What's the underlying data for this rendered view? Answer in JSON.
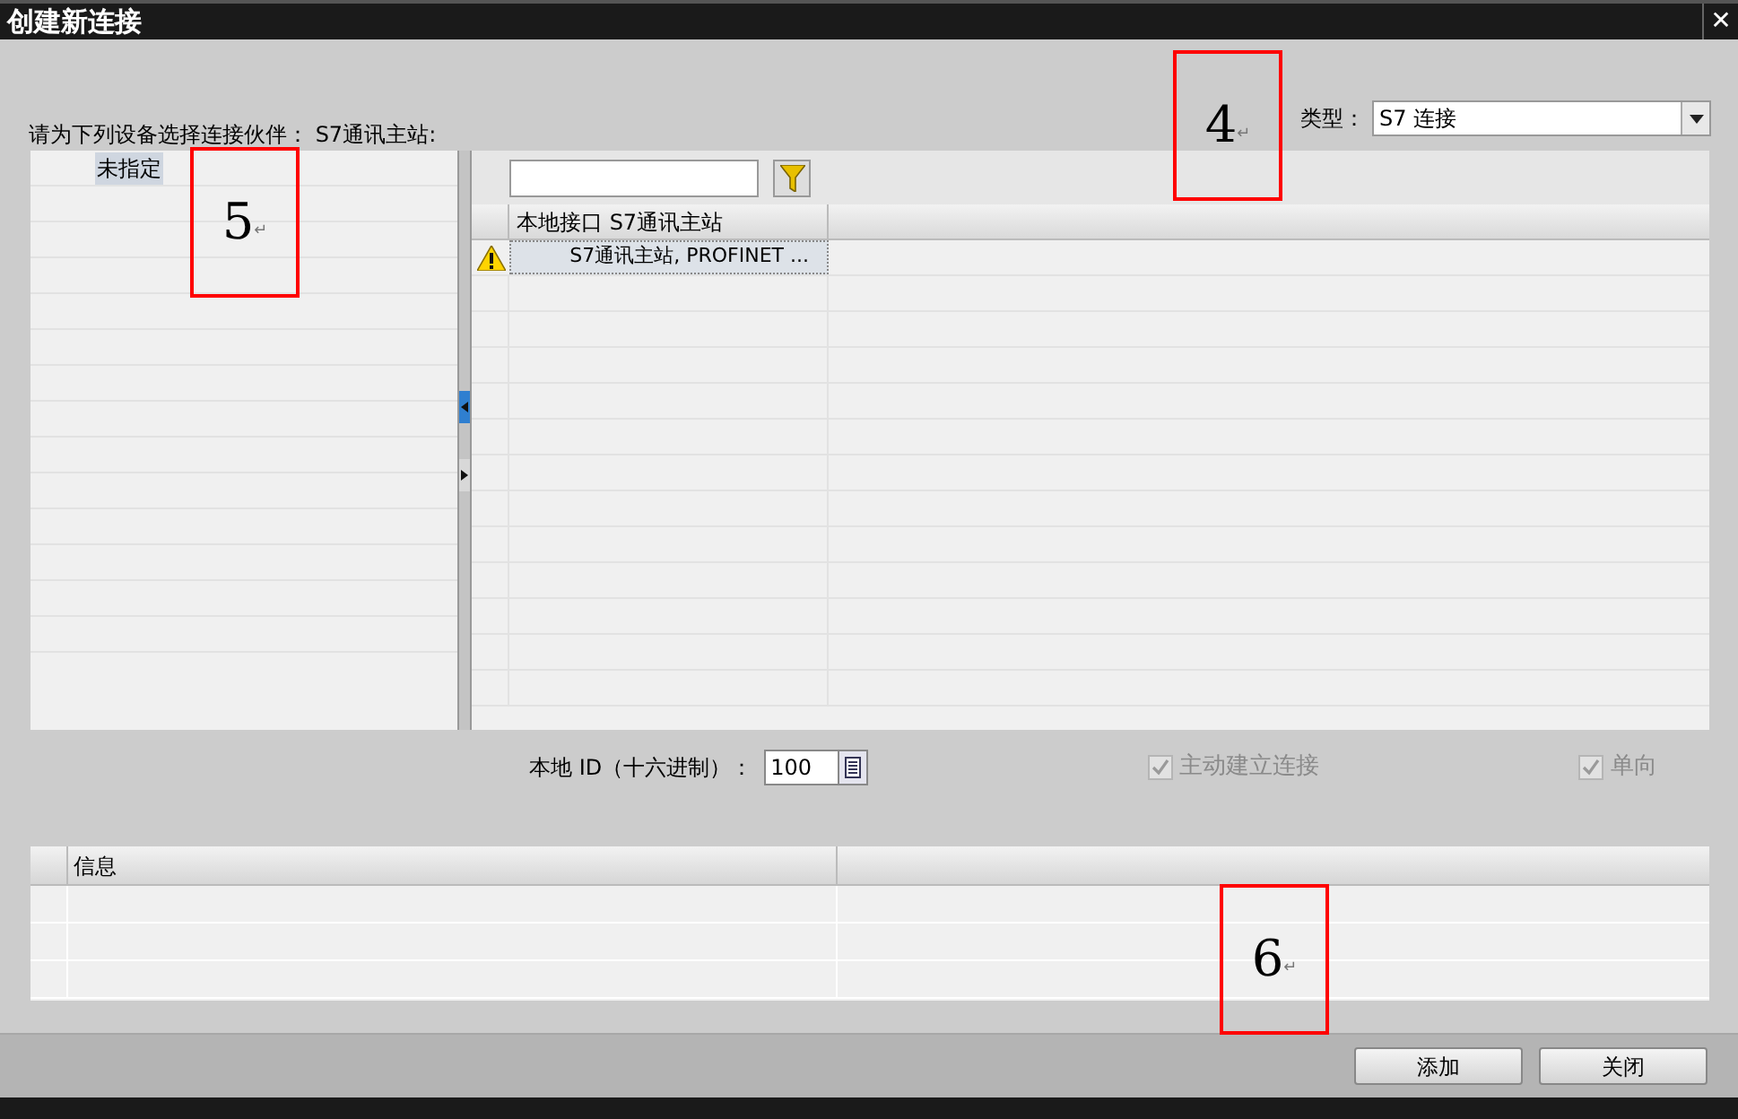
{
  "window": {
    "title": "创建新连接",
    "close": "✕"
  },
  "prompt": "请为下列设备选择连接伙伴： S7通讯主站:",
  "type_field": {
    "label": "类型：",
    "value": "S7 连接"
  },
  "partner_list": {
    "items": [
      {
        "label": "未指定",
        "selected": true
      }
    ]
  },
  "interface_table": {
    "columns": [
      "本地接口 S7通讯主站"
    ],
    "rows": [
      {
        "warning": true,
        "cells": [
          "S7通讯主站, PROFINET ..."
        ],
        "selected": true
      }
    ]
  },
  "local_id": {
    "label": "本地 ID（十六进制）：",
    "value": "100"
  },
  "options": [
    {
      "label": "主动建立连接",
      "checked": true,
      "disabled": true
    },
    {
      "label": "单向",
      "checked": true,
      "disabled": true
    }
  ],
  "info_table": {
    "columns": [
      "信息"
    ]
  },
  "buttons": [
    "添加",
    "关闭"
  ],
  "callouts": [
    {
      "number": "4",
      "mark": "↵"
    },
    {
      "number": "5",
      "mark": "↵"
    },
    {
      "number": "6",
      "mark": "↵"
    }
  ]
}
